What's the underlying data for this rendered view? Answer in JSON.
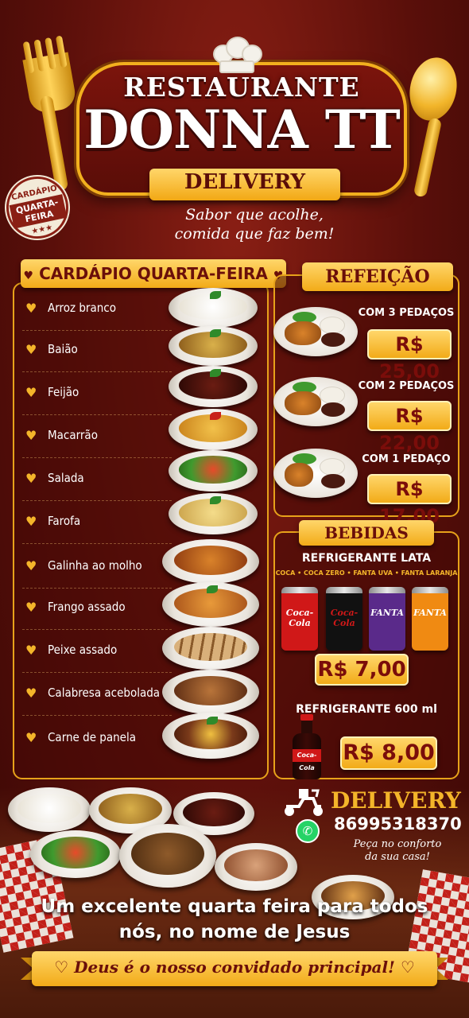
{
  "header": {
    "title_top": "RESTAURANTE",
    "title_main": "DONNA TT",
    "ribbon": "DELIVERY",
    "tagline_line1": "Sabor que acolhe,",
    "tagline_line2": "comida que faz bem!"
  },
  "badge": {
    "small": "CARDÁPIO",
    "big": "QUARTA-FEIRA",
    "stars": "★★★"
  },
  "menu": {
    "header": "CARDÁPIO QUARTA-FEIRA",
    "items": [
      {
        "label": "Arroz branco"
      },
      {
        "label": "Baião"
      },
      {
        "label": "Feijão"
      },
      {
        "label": "Macarrão"
      },
      {
        "label": "Salada"
      },
      {
        "label": "Farofa"
      },
      {
        "label": "Galinha ao molho"
      },
      {
        "label": "Frango assado"
      },
      {
        "label": "Peixe assado"
      },
      {
        "label": "Calabresa acebolada"
      },
      {
        "label": "Carne de panela"
      }
    ]
  },
  "refeicao": {
    "header": "REFEIÇÃO",
    "options": [
      {
        "label": "COM 3 PEDAÇOS",
        "price": "R$ 25,00"
      },
      {
        "label": "COM 2 PEDAÇOS",
        "price": "R$ 22,00"
      },
      {
        "label": "COM 1 PEDAÇO",
        "price": "R$ 17,00"
      }
    ]
  },
  "bebidas": {
    "header": "BEBIDAS",
    "lata_title": "REFRIGERANTE LATA",
    "lata_brands": "COCA • COCA ZERO • FANTA UVA • FANTA LARANJA",
    "cans": [
      "Coca-Cola",
      "Coca-Cola",
      "FANTA",
      "FANTA"
    ],
    "lata_price": "R$ 7,00",
    "garrafa_title": "REFRIGERANTE 600 ml",
    "garrafa_label": "Coca-Cola",
    "garrafa_price": "R$ 8,00"
  },
  "delivery": {
    "word": "DELIVERY",
    "phone": "86995318370",
    "note_line1": "Peça no conforto",
    "note_line2": "da sua casa!"
  },
  "footer": {
    "blessing_line1": "Um excelente quarta feira para todos",
    "blessing_line2": "nós, no nome de Jesus",
    "ribbon": "Deus é o nosso convidado principal!"
  },
  "colors": {
    "background": "#5a0f0a",
    "gold": "#f4b52a",
    "coca_red": "#d01818",
    "coca_zero": "#111111",
    "fanta_uva": "#5a2a8a",
    "fanta_laranja": "#f08a12"
  }
}
